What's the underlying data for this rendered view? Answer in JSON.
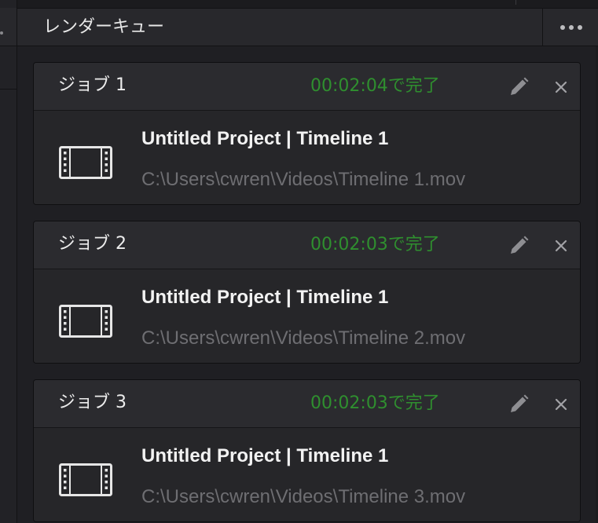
{
  "panel": {
    "title": "レンダーキュー",
    "menu_icon": "more-horizontal-icon"
  },
  "jobs": [
    {
      "name": "ジョブ 1",
      "status": "00:02:04で完了",
      "project": "Untitled Project | Timeline 1",
      "path": "C:\\Users\\cwren\\Videos\\Timeline 1.mov",
      "icon": "film-icon"
    },
    {
      "name": "ジョブ 2",
      "status": "00:02:03で完了",
      "project": "Untitled Project | Timeline 1",
      "path": "C:\\Users\\cwren\\Videos\\Timeline 2.mov",
      "icon": "film-icon"
    },
    {
      "name": "ジョブ 3",
      "status": "00:02:03で完了",
      "project": "Untitled Project | Timeline 1",
      "path": "C:\\Users\\cwren\\Videos\\Timeline 3.mov",
      "icon": "film-icon"
    }
  ],
  "colors": {
    "status_complete": "#2f8f2f",
    "panel_background": "#1f1f23",
    "card_header": "#2b2b2f",
    "path_text": "#6e6e72"
  }
}
